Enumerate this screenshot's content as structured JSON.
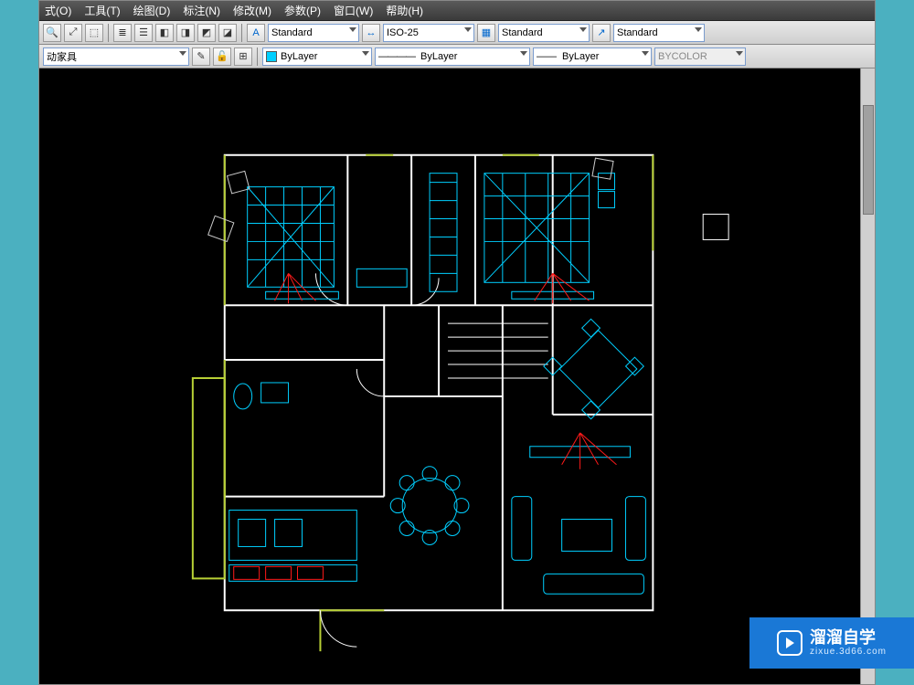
{
  "menu": {
    "items": [
      "式(O)",
      "工具(T)",
      "绘图(D)",
      "标注(N)",
      "修改(M)",
      "参数(P)",
      "窗口(W)",
      "帮助(H)"
    ]
  },
  "toolbar1": {
    "style1": "Standard",
    "dimstyle": "ISO-25",
    "style2": "Standard",
    "style3": "Standard"
  },
  "toolbar2": {
    "layer": "动家具",
    "colorLabel": "ByLayer",
    "linetype": "ByLayer",
    "lineweight": "ByLayer",
    "plotstyle": "BYCOLOR"
  },
  "watermark": {
    "title": "溜溜自学",
    "url": "zixue.3d66.com"
  }
}
